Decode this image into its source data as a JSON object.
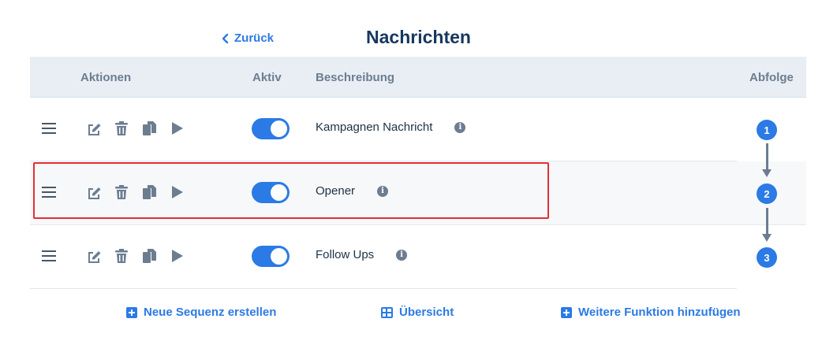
{
  "header": {
    "back_label": "Zurück",
    "title": "Nachrichten"
  },
  "table": {
    "columns": {
      "actions": "Aktionen",
      "active": "Aktiv",
      "description": "Beschreibung",
      "sequence": "Abfolge"
    },
    "rows": [
      {
        "description": "Kampagnen Nachricht",
        "active": true,
        "sequence": "1",
        "info_icon": "info-icon"
      },
      {
        "description": "Opener",
        "active": true,
        "sequence": "2",
        "info_icon": "info-icon"
      },
      {
        "description": "Follow Ups",
        "active": true,
        "sequence": "3",
        "info_icon": "info-icon"
      }
    ],
    "row_action_icons": [
      "edit-icon",
      "trash-icon",
      "copy-icon",
      "play-icon"
    ]
  },
  "footer": {
    "new_sequence": "Neue Sequenz erstellen",
    "overview": "Übersicht",
    "add_function": "Weitere Funktion hinzufügen"
  },
  "colors": {
    "accent": "#2b7ae5",
    "title": "#17375e",
    "header_bg": "#e9eef5",
    "highlight": "#e32f35",
    "icon_gray": "#6c7d90"
  }
}
